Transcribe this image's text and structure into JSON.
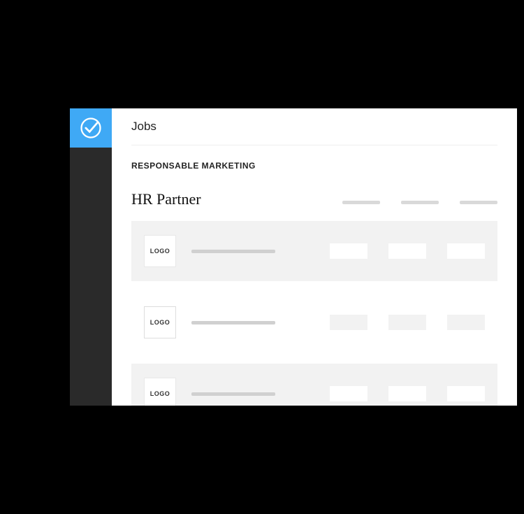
{
  "page": {
    "title": "Jobs",
    "breadcrumb": "RESPONSABLE MARKETING",
    "section_title": "HR Partner"
  },
  "rows": [
    {
      "logo_label": "LOGO",
      "shaded": true
    },
    {
      "logo_label": "LOGO",
      "shaded": false
    },
    {
      "logo_label": "LOGO",
      "shaded": true
    }
  ],
  "colors": {
    "accent": "#3fa9f5",
    "sidebar": "#2a2a2a"
  }
}
